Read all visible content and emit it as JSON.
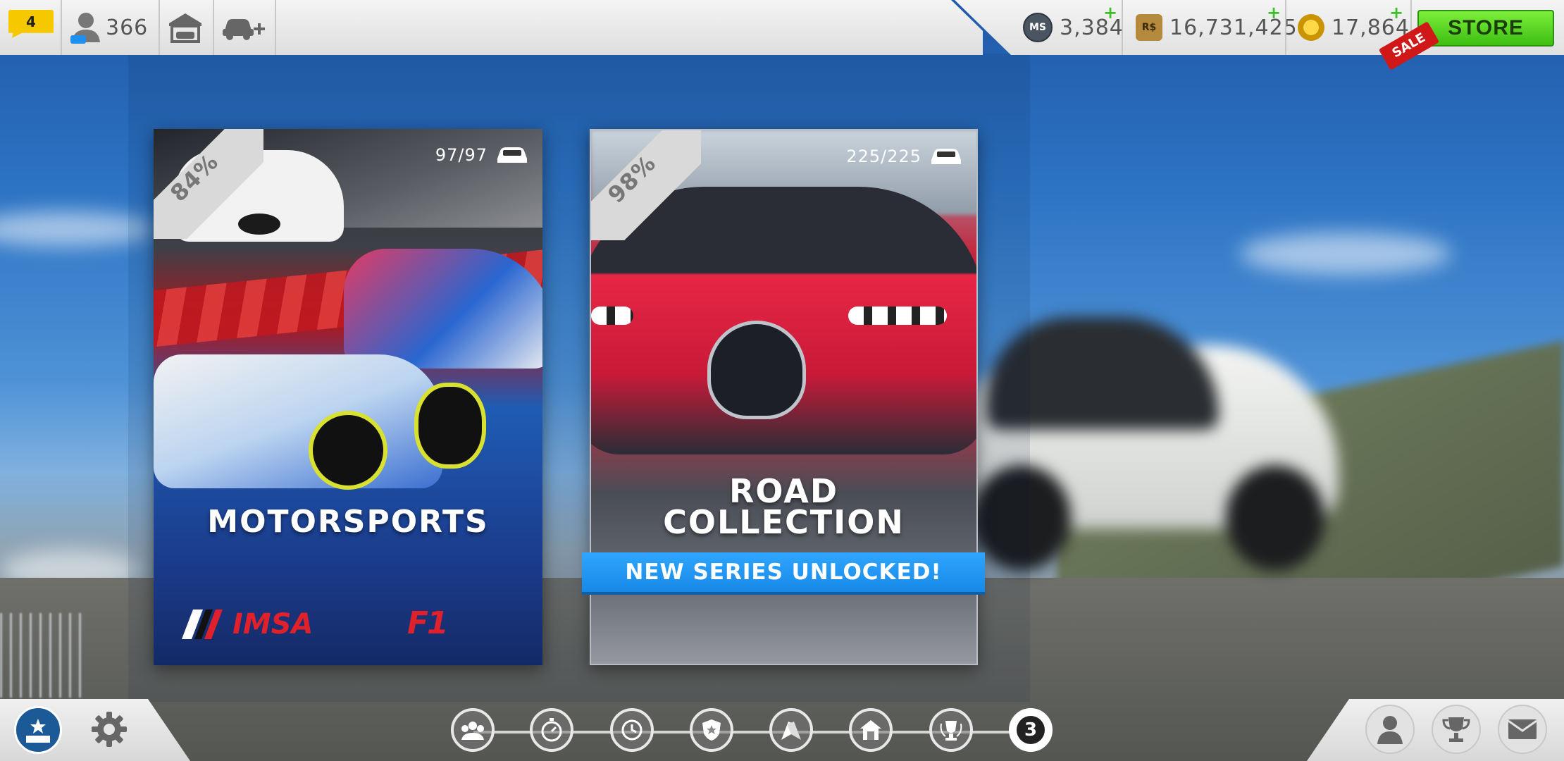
{
  "topbar": {
    "messages_count": "4",
    "friends_count": "366",
    "mastery_value": "3,384",
    "mastery_icon_label": "MS",
    "rs_value": "16,731,425",
    "rs_icon_label": "R$",
    "gold_value": "17,864",
    "store_label": "STORE",
    "sale_label": "SALE",
    "plus_symbol": "+"
  },
  "cards": {
    "motorsports": {
      "percent": "84%",
      "cars_count": "97/97",
      "title": "MOTORSPORTS",
      "logo_left": "IMSA",
      "logo_right": "F1"
    },
    "road": {
      "percent": "98%",
      "cars_count": "225/225",
      "title_line1": "ROAD",
      "title_line2": "COLLECTION",
      "banner": "NEW SERIES UNLOCKED!"
    }
  },
  "nav": {
    "active_tier": "3",
    "nodes": [
      "community-icon",
      "stopwatch-icon",
      "history-icon",
      "shield-icon",
      "flags-icon",
      "garage-icon",
      "trophy-laurel-icon",
      "tier-3-icon"
    ]
  },
  "colors": {
    "store_green": "#4fd21e",
    "banner_blue": "#1f96f2",
    "message_yellow": "#f6c800",
    "sale_red": "#d01818"
  }
}
